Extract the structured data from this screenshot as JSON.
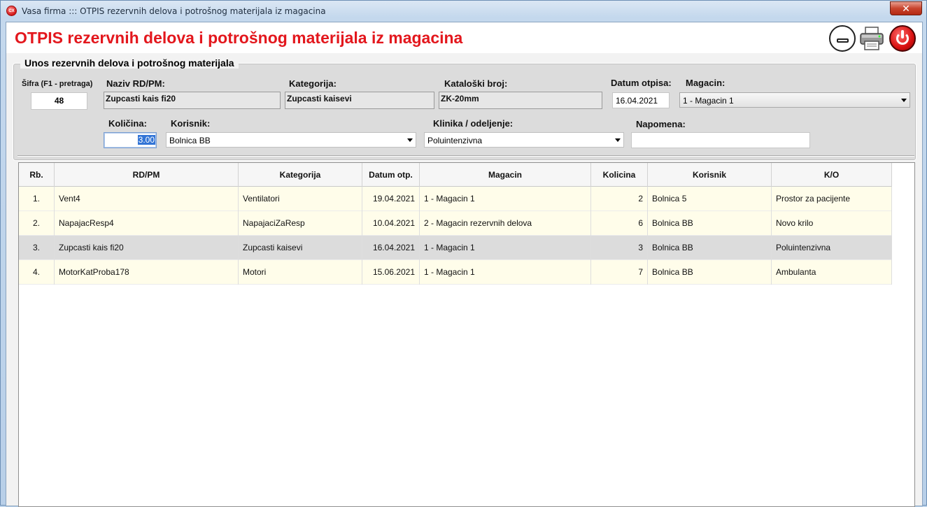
{
  "window": {
    "title": "Vasa firma ::: OTPIS rezervnih delova i potrošnog materijala iz magacina",
    "app_icon": "CX",
    "close_label": "✕"
  },
  "header": {
    "title": "OTPIS rezervnih delova i potrošnog materijala iz magacina"
  },
  "form": {
    "legend": "Unos rezervnih delova i potrošnog materijala",
    "sifra_label": "Šifra (F1 - pretraga)",
    "sifra_value": "48",
    "naziv_label": "Naziv RD/PM:",
    "naziv_value": "Zupcasti kais fi20",
    "kategorija_label": "Kategorija:",
    "kategorija_value": "Zupcasti kaisevi",
    "kataloski_label": "Kataloški broj:",
    "kataloski_value": "ZK-20mm",
    "datum_label": "Datum otpisa:",
    "datum_value": "16.04.2021",
    "magacin_label": "Magacin:",
    "magacin_value": "1 - Magacin 1",
    "kolicina_label": "Količina:",
    "kolicina_value": "3.00",
    "korisnik_label": "Korisnik:",
    "korisnik_value": "Bolnica BB",
    "klinika_label": "Klinika / odeljenje:",
    "klinika_value": "Poluintenzivna",
    "napomena_label": "Napomena:",
    "napomena_value": ""
  },
  "table": {
    "columns": [
      "Rb.",
      "RD/PM",
      "Kategorija",
      "Datum otp.",
      "Magacin",
      "Kolicina",
      "Korisnik",
      "K/O"
    ],
    "rows": [
      {
        "rb": "1.",
        "rdpm": "Vent4",
        "kategorija": "Ventilatori",
        "datum": "19.04.2021",
        "magacin": "1 - Magacin 1",
        "kolicina": "2",
        "korisnik": "Bolnica 5",
        "ko": "Prostor za pacijente"
      },
      {
        "rb": "2.",
        "rdpm": "NapajacResp4",
        "kategorija": "NapajaciZaResp",
        "datum": "10.04.2021",
        "magacin": "2 - Magacin rezervnih delova",
        "kolicina": "6",
        "korisnik": "Bolnica BB",
        "ko": "Novo krilo"
      },
      {
        "rb": "3.",
        "rdpm": "Zupcasti kais fi20",
        "kategorija": "Zupcasti kaisevi",
        "datum": "16.04.2021",
        "magacin": "1 - Magacin 1",
        "kolicina": "3",
        "korisnik": "Bolnica BB",
        "ko": "Poluintenzivna"
      },
      {
        "rb": "4.",
        "rdpm": "MotorKatProba178",
        "kategorija": "Motori",
        "datum": "15.06.2021",
        "magacin": "1 - Magacin 1",
        "kolicina": "7",
        "korisnik": "Bolnica BB",
        "ko": "Ambulanta"
      }
    ],
    "selected_row": 3
  },
  "icons": {
    "minimize": "minimize-icon",
    "print": "printer-icon",
    "power": "power-icon"
  },
  "colors": {
    "title_red": "#e3171d",
    "row_yellow": "#fffdea",
    "row_selected": "#dcdcdc"
  }
}
